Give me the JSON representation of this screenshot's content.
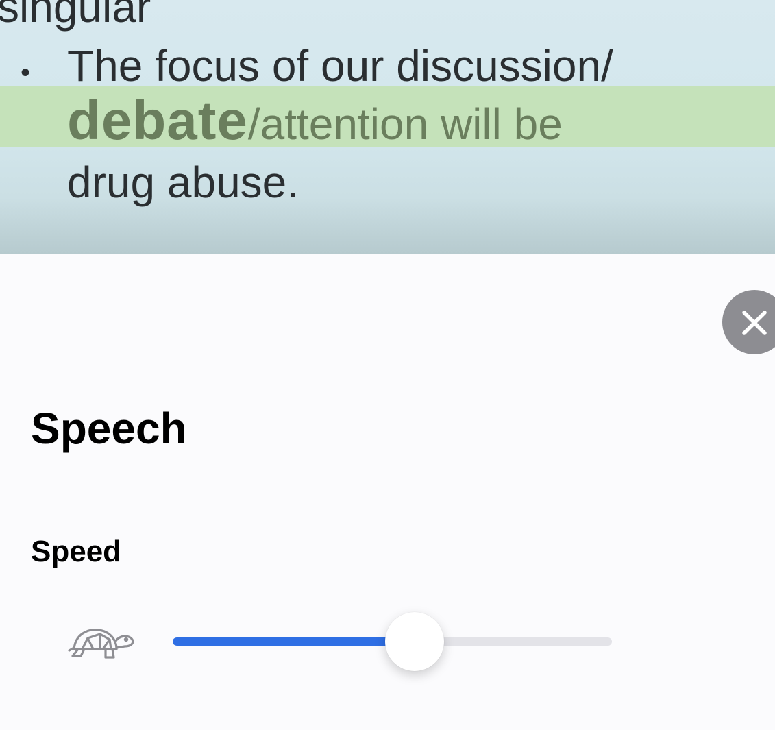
{
  "document": {
    "prev_line": "singular",
    "bullet": "•",
    "line1": "The focus of our discussion/",
    "line2_current_word": "debate",
    "line2_rest": "/attention will be",
    "line3": "drug abuse."
  },
  "sheet": {
    "title": "Speech",
    "speed_label": "Speed",
    "speed_value": 0.55
  },
  "icons": {
    "close": "close-icon",
    "slow_speed": "turtle-icon"
  },
  "colors": {
    "accent": "#2f6fe4",
    "highlight": "#c5e2ba",
    "close_button": "#8d8d92"
  }
}
